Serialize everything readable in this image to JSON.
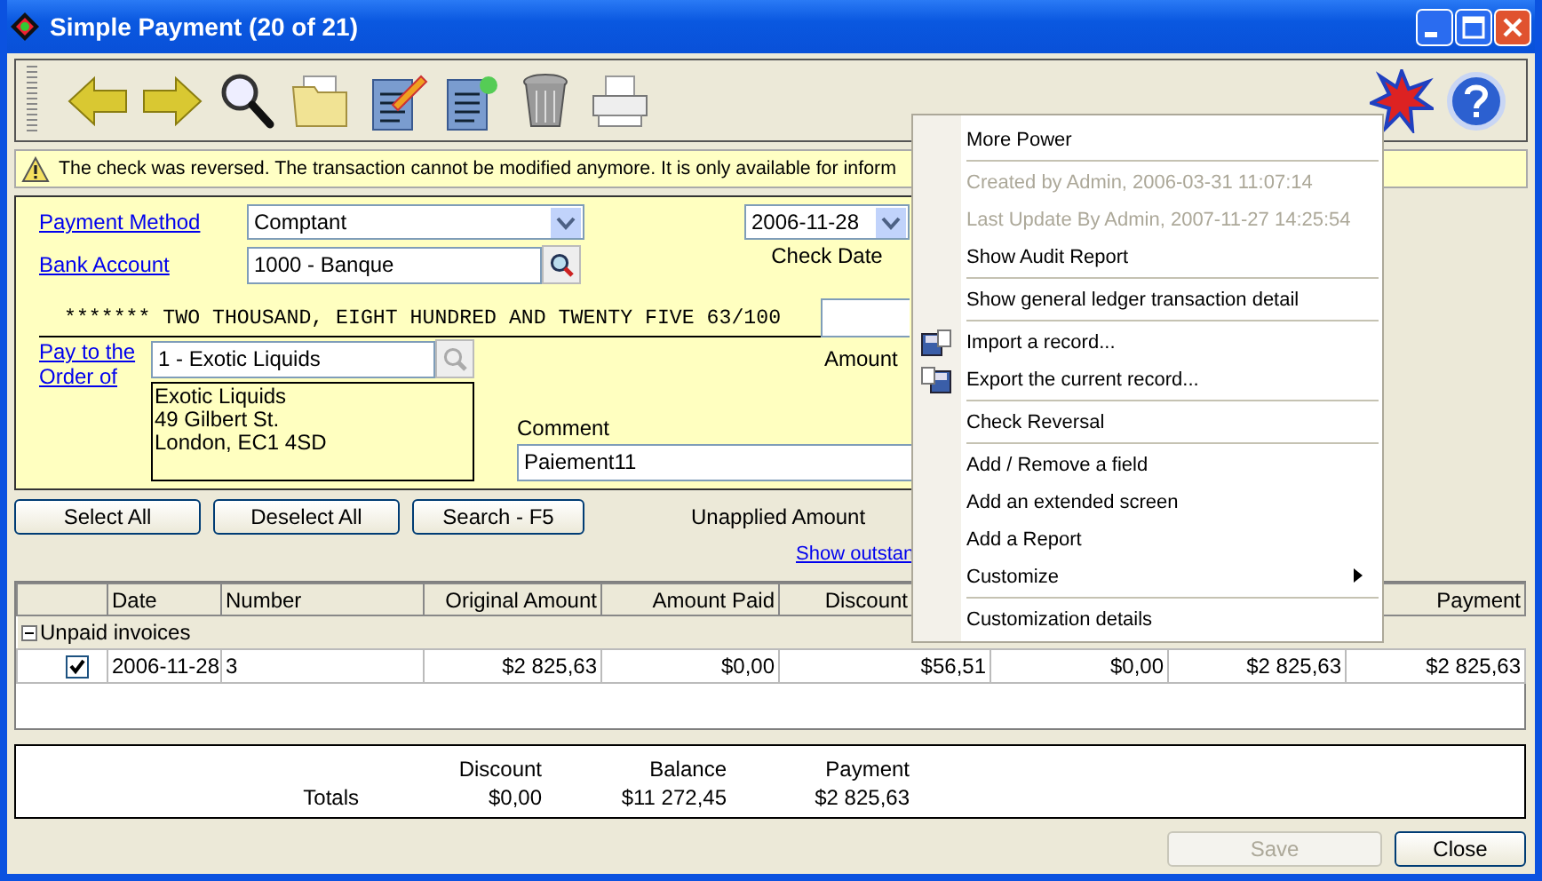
{
  "window": {
    "title": "Simple Payment (20 of 21)"
  },
  "warning": {
    "text": "The check was reversed. The transaction cannot be modified anymore. It is only available for inform"
  },
  "form": {
    "payment_method": {
      "label": "Payment Method",
      "value": "Comptant"
    },
    "bank_account": {
      "label": "Bank Account",
      "value": "1000 - Banque"
    },
    "check_date": {
      "label": "Check Date",
      "value": "2006-11-28"
    },
    "amount_words": "******* TWO THOUSAND, EIGHT HUNDRED AND TWENTY FIVE 63/100",
    "amount": {
      "label": "Amount"
    },
    "pay_to": {
      "label": "Pay to the Order of",
      "value": "1 - Exotic Liquids"
    },
    "address": [
      "Exotic Liquids",
      "49 Gilbert St.",
      "London, EC1 4SD"
    ],
    "comment": {
      "label": "Comment",
      "value": "Paiement11"
    }
  },
  "actions": {
    "buttons": [
      "Select All",
      "Deselect All",
      "Search - F5"
    ],
    "unapplied_label": "Unapplied Amount",
    "outstanding_link": "Show outstan"
  },
  "table": {
    "columns": [
      {},
      {
        "label": "Date"
      },
      {
        "label": "Number"
      },
      {
        "label": "Original Amount"
      },
      {
        "label": "Amount Paid"
      },
      {
        "label": "Discount"
      },
      {},
      {},
      {
        "label": "Payment"
      }
    ],
    "groups": [
      {
        "label": "Unpaid invoices",
        "expanded": true,
        "rows": [
          {
            "checked": true,
            "cells": [
              "2006-11-28",
              "3",
              "$2 825,63",
              "$0,00",
              "$56,51",
              "$0,00",
              "$2 825,63",
              "$2 825,63"
            ]
          }
        ]
      }
    ]
  },
  "totals": {
    "label": "Totals",
    "columns": [
      {
        "heading": "Discount",
        "value": "$0,00"
      },
      {
        "heading": "Balance",
        "value": "$11 272,45"
      },
      {
        "heading": "Payment",
        "value": "$2 825,63"
      }
    ]
  },
  "buttons": [
    {
      "label": "Save",
      "disabled": true
    },
    {
      "label": "Close",
      "disabled": false
    }
  ],
  "context_menu": {
    "items": [
      {
        "kind": "item",
        "label": "More Power",
        "disabled": false
      },
      {
        "kind": "separator"
      },
      {
        "kind": "item",
        "label": "Created by Admin, 2006-03-31 11:07:14",
        "disabled": true
      },
      {
        "kind": "item",
        "label": "Last Update By Admin, 2007-11-27 14:25:54",
        "disabled": true
      },
      {
        "kind": "item",
        "label": "Show Audit Report",
        "disabled": false
      },
      {
        "kind": "separator"
      },
      {
        "kind": "item",
        "label": "Show general ledger transaction detail",
        "disabled": false
      },
      {
        "kind": "separator"
      },
      {
        "kind": "import",
        "label": "Import a record...",
        "disabled": false
      },
      {
        "kind": "export",
        "label": "Export the current record...",
        "disabled": false
      },
      {
        "kind": "separator"
      },
      {
        "kind": "item",
        "label": "Check Reversal",
        "disabled": false
      },
      {
        "kind": "separator"
      },
      {
        "kind": "item",
        "label": "Add / Remove a field",
        "disabled": false
      },
      {
        "kind": "item",
        "label": "Add an extended screen",
        "disabled": false
      },
      {
        "kind": "item",
        "label": "Add a Report",
        "disabled": false
      },
      {
        "kind": "submenu",
        "label": "Customize",
        "disabled": false
      },
      {
        "kind": "separator"
      },
      {
        "kind": "item",
        "label": "Customization details",
        "disabled": false
      }
    ]
  }
}
